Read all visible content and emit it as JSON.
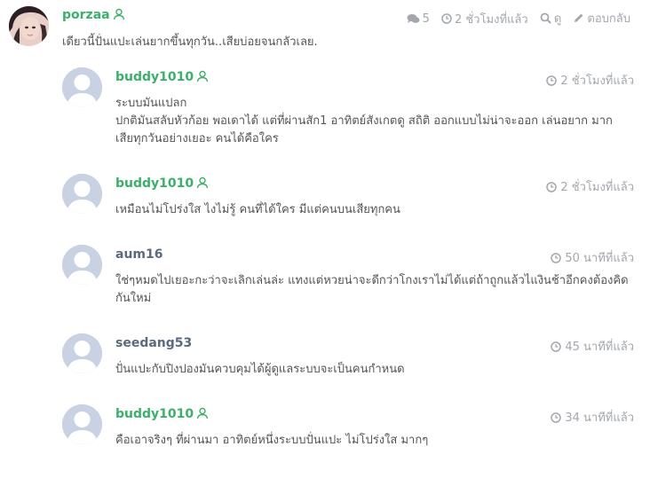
{
  "post": {
    "author": "porzaa",
    "replies_count": "5",
    "time": "2 ชั่วโมงที่แล้ว",
    "view_label": "ดู",
    "reply_label": "ตอบกลับ",
    "text": "เดียวนี้ปั่นแปะเล่นยากขึ้นทุกวัน..เสียบ่อยจนกลัวเลย."
  },
  "comments": [
    {
      "author": "buddy1010",
      "time": "2 ชั่วโมงที่แล้ว",
      "lines": [
        "ระบบมันแปลก",
        "ปกติมันสลับหัวก้อย พอเดาได้ แต่ที่ผ่านสัก1 อาทิตย์สังเกตดู สถิติ ออกแบบไม่น่าจะออก เล่นอยาก มาก",
        "เสียทุกวันอย่างเยอะ คนได้คือใคร"
      ]
    },
    {
      "author": "buddy1010",
      "time": "2 ชั่วโมงที่แล้ว",
      "lines": [
        "เหมือนไม่โปร่งใส ไงไม่รู้ คนที่ได้ใคร มีแต่คนบนเสียทุกคน"
      ]
    },
    {
      "author": "aum16",
      "time": "50 นาทีที่แล้ว",
      "lines": [
        "ใช่ๆหมดไปเยอะกะว่าจะเลิกเล่นล่ะ แทงแต่หวยน่าจะดีกว่าโกงเราไม่ได้แต่ถ้าถูกแล้วไแงินช้าอีกคงต้องคิด",
        "กันใหม่"
      ]
    },
    {
      "author": "seedang53",
      "time": "45 นาทีที่แล้ว",
      "lines": [
        "ปั่นแปะกับปิงปองมันควบคุมได้ผู้ดูแลระบบจะเป็นคนกำหนด"
      ]
    },
    {
      "author": "buddy1010",
      "time": "34 นาทีที่แล้ว",
      "lines": [
        "คือเอาจริงๆ ที่ผ่านมา อาทิตย์หนึ่งระบบปั่นแปะ ไม่โปร่งใส มากๆ"
      ]
    }
  ],
  "colors": {
    "green": "#3bb06a",
    "meta_gray": "#a2a7ad",
    "avatar_placeholder": "#c9d2e3"
  },
  "icons": [
    "user-icon",
    "comments-icon",
    "clock-icon",
    "search-icon",
    "pencil-icon",
    "avatar-placeholder-icon"
  ]
}
